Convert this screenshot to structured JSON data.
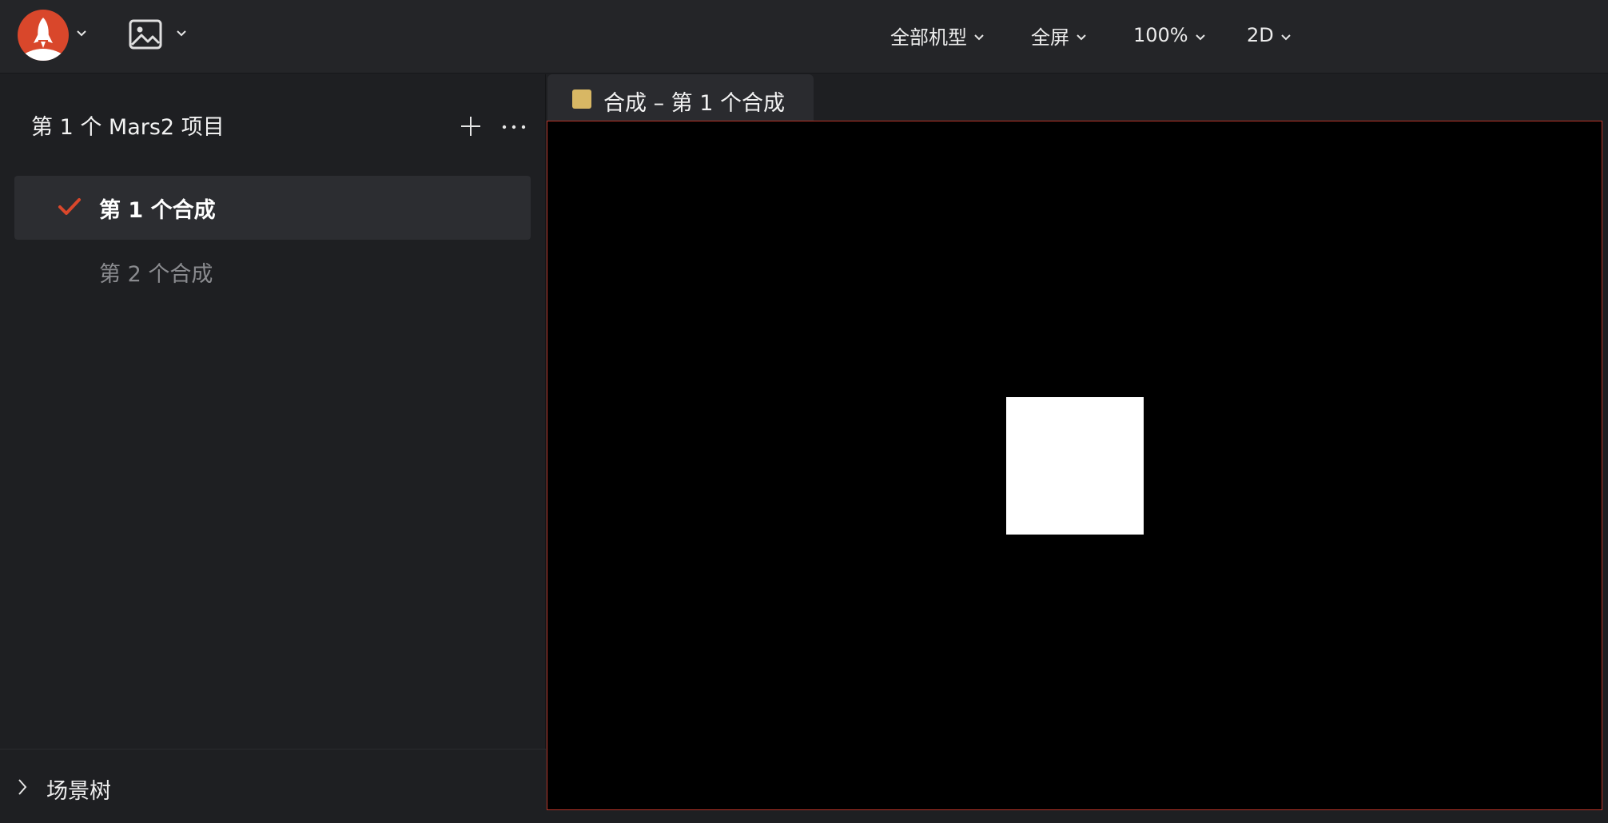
{
  "topbar": {
    "logo_icon": "rocket-icon",
    "logo_color": "#d9472b",
    "media_icon": "image-icon",
    "device_label": "全部机型",
    "fullscreen_label": "全屏",
    "zoom_label": "100%",
    "mode_label": "2D"
  },
  "sidebar": {
    "project_title": "第 1 个 Mars2 项目",
    "add_icon": "plus-icon",
    "more_icon": "more-horizontal-icon",
    "compositions": [
      {
        "label": "第 1 个合成",
        "active": true,
        "icon": "check-icon"
      },
      {
        "label": "第 2 个合成",
        "active": false
      }
    ],
    "scene_tree_label": "场景树",
    "scene_tree_icon": "chevron-right-icon"
  },
  "tabs": [
    {
      "label": "合成 – 第 1 个合成",
      "swatch_color": "#d8b764"
    }
  ],
  "colors": {
    "accent": "#d9472b",
    "canvas_border": "#b8352a",
    "canvas_bg": "#000000"
  }
}
